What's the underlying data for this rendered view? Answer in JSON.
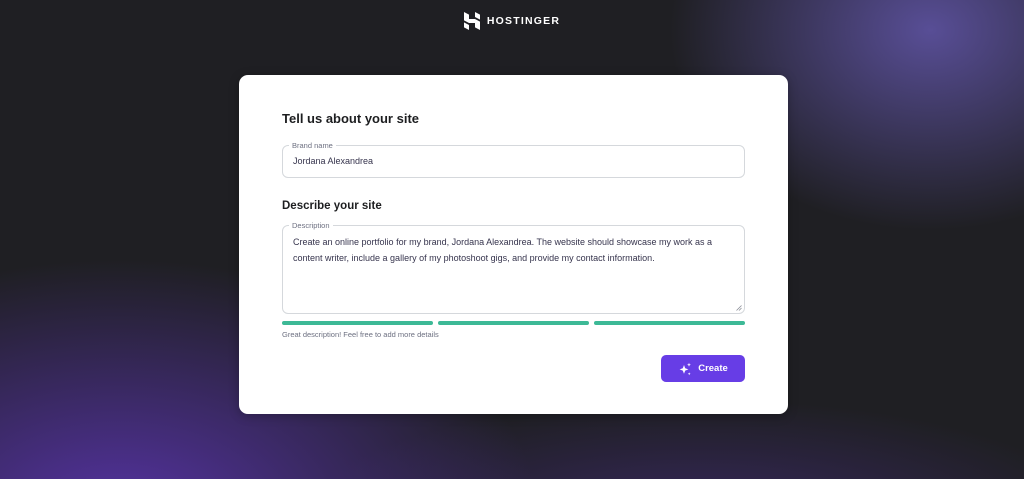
{
  "header": {
    "brand_name": "HOSTINGER",
    "logo_icon": "hostinger-h-logo"
  },
  "form": {
    "title": "Tell us about your site",
    "brand_field": {
      "label": "Brand name",
      "value": "Jordana Alexandrea"
    },
    "describe_title": "Describe your site",
    "description_field": {
      "label": "Description",
      "value": "Create an online portfolio for my brand, Jordana Alexandrea. The website should showcase my work as a content writer, include a gallery of my photoshoot gigs, and provide my contact information."
    },
    "strength": {
      "segments_filled": 3,
      "segments_total": 3,
      "hint": "Great description! Feel free to add more details"
    },
    "create_button": {
      "label": "Create",
      "icon": "sparkle-icon"
    }
  },
  "colors": {
    "accent": "#673de6",
    "strength_good": "#3db996",
    "card_bg": "#ffffff",
    "page_bg": "#1f1f23"
  }
}
